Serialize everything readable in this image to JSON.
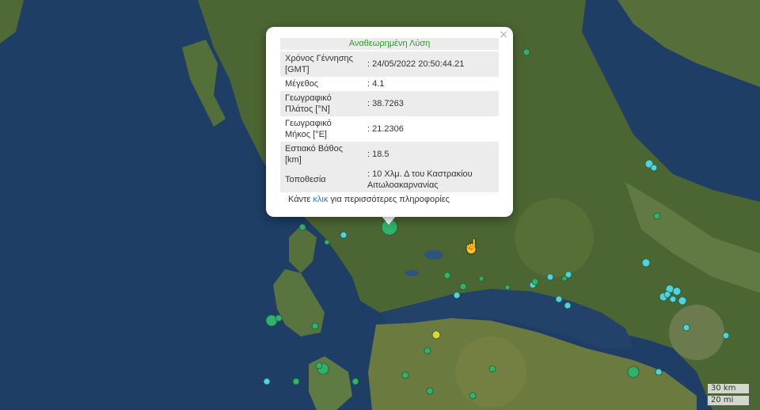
{
  "popup": {
    "title": "Αναθεωρημένη Λύση",
    "close_glyph": "×",
    "rows": [
      {
        "label": "Χρόνος Γέννησης [GMT]",
        "value": ": 24/05/2022 20:50:44.21"
      },
      {
        "label": "Μέγεθος",
        "value": ": 4.1"
      },
      {
        "label": "Γεωγραφικό Πλάτος [°N]",
        "value": ": 38.7263"
      },
      {
        "label": "Γεωγραφικό Μήκος [°E]",
        "value": ": 21.2306"
      },
      {
        "label": "Εστιακό Βάθος [km]",
        "value": ": 18.5"
      },
      {
        "label": "Τοποθεσία",
        "value": ": 10 Χλμ. Δ του Καστρακίου Αιτωλοακαρνανίας"
      }
    ],
    "more_prefix": "Κάντε ",
    "more_link": "κλικ",
    "more_suffix": " για περισσότερες πληροφορίες"
  },
  "scale": {
    "km": "30 km",
    "mi": "20 mi"
  },
  "colors": {
    "marker_green": "#2fb36a",
    "marker_cyan": "#4fd3df",
    "marker_yellow": "#e6cf3a",
    "link": "#2a7bd0",
    "title_green": "#2a9c2a"
  },
  "icons": {
    "cursor": "hand-cursor-icon"
  }
}
